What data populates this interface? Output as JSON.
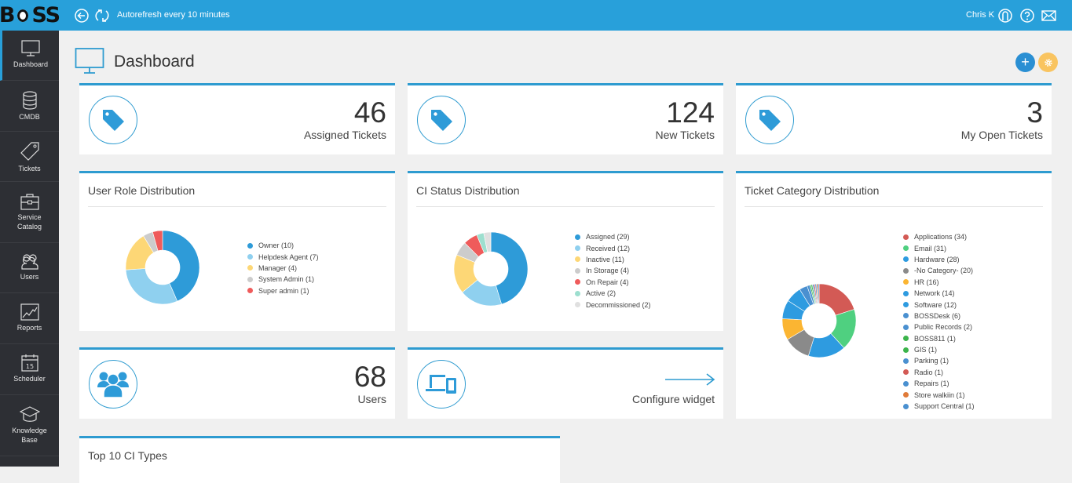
{
  "topbar": {
    "logo": "BOSS",
    "autorefresh": "Autorefresh every 10 minutes",
    "user_name": "Chris K"
  },
  "sidebar": {
    "items": [
      {
        "label": "Dashboard",
        "icon": "monitor-icon",
        "active": true
      },
      {
        "label": "CMDB",
        "icon": "database-icon"
      },
      {
        "label": "Tickets",
        "icon": "tag-icon"
      },
      {
        "label": "Service Catalog",
        "icon": "briefcase-icon"
      },
      {
        "label": "Users",
        "icon": "users-icon"
      },
      {
        "label": "Reports",
        "icon": "chart-icon"
      },
      {
        "label": "Scheduler",
        "icon": "calendar-icon",
        "calendar_day": "15"
      },
      {
        "label": "Knowledge Base",
        "icon": "graduation-cap-icon"
      }
    ]
  },
  "page": {
    "title": "Dashboard",
    "add_button": "+",
    "colors": {
      "accent": "#2e9bd0",
      "settings": "#f9c460"
    }
  },
  "stats": {
    "assigned": {
      "value": "46",
      "label": "Assigned Tickets"
    },
    "new": {
      "value": "124",
      "label": "New Tickets"
    },
    "open": {
      "value": "3",
      "label": "My Open Tickets"
    },
    "users": {
      "value": "68",
      "label": "Users"
    },
    "configure": {
      "label": "Configure widget"
    }
  },
  "top_ci": {
    "title": "Top 10 CI Types"
  },
  "chart_data": [
    {
      "type": "pie",
      "title": "User Role Distribution",
      "legend": "right",
      "slices": [
        {
          "label": "Owner (10)",
          "name": "Owner",
          "value": 10,
          "color": "#2e9bd8"
        },
        {
          "label": "Helpdesk Agent (7)",
          "name": "Helpdesk Agent",
          "value": 7,
          "color": "#8fd0ef"
        },
        {
          "label": "Manager (4)",
          "name": "Manager",
          "value": 4,
          "color": "#fdd776"
        },
        {
          "label": "System Admin (1)",
          "name": "System Admin",
          "value": 1,
          "color": "#cccccc"
        },
        {
          "label": "Super admin (1)",
          "name": "Super admin",
          "value": 1,
          "color": "#ef5b5b"
        }
      ]
    },
    {
      "type": "pie",
      "title": "CI Status Distribution",
      "legend": "right",
      "slices": [
        {
          "label": "Assigned (29)",
          "name": "Assigned",
          "value": 29,
          "color": "#2e9bd8"
        },
        {
          "label": "Received (12)",
          "name": "Received",
          "value": 12,
          "color": "#8fd0ef"
        },
        {
          "label": "Inactive (11)",
          "name": "Inactive",
          "value": 11,
          "color": "#fdd776"
        },
        {
          "label": "In Storage (4)",
          "name": "In Storage",
          "value": 4,
          "color": "#cccccc"
        },
        {
          "label": "On Repair (4)",
          "name": "On Repair",
          "value": 4,
          "color": "#ef5b5b"
        },
        {
          "label": "Active (2)",
          "name": "Active",
          "value": 2,
          "color": "#9ddfcf"
        },
        {
          "label": "Decommissioned (2)",
          "name": "Decommissioned",
          "value": 2,
          "color": "#e0e0e0"
        }
      ]
    },
    {
      "type": "pie",
      "title": "Ticket Category Distribution",
      "legend": "right",
      "slices": [
        {
          "label": "Applications (34)",
          "name": "Applications",
          "value": 34,
          "color": "#d35a55"
        },
        {
          "label": "Email (31)",
          "name": "Email",
          "value": 31,
          "color": "#4fd080"
        },
        {
          "label": "Hardware (28)",
          "name": "Hardware",
          "value": 28,
          "color": "#2e9be0"
        },
        {
          "label": "-No Category- (20)",
          "name": "-No Category-",
          "value": 20,
          "color": "#8a8a8a"
        },
        {
          "label": "HR (16)",
          "name": "HR",
          "value": 16,
          "color": "#fbb532"
        },
        {
          "label": "Network (14)",
          "name": "Network",
          "value": 14,
          "color": "#2e9be0"
        },
        {
          "label": "Software (12)",
          "name": "Software",
          "value": 12,
          "color": "#2e9be0"
        },
        {
          "label": "BOSSDesk (6)",
          "name": "BOSSDesk",
          "value": 6,
          "color": "#4a90d0"
        },
        {
          "label": "Public Records (2)",
          "name": "Public Records",
          "value": 2,
          "color": "#4a90d0"
        },
        {
          "label": "BOSS811 (1)",
          "name": "BOSS811",
          "value": 1,
          "color": "#3cb44b"
        },
        {
          "label": "GIS (1)",
          "name": "GIS",
          "value": 1,
          "color": "#3cb44b"
        },
        {
          "label": "Parking (1)",
          "name": "Parking",
          "value": 1,
          "color": "#4a90d0"
        },
        {
          "label": "Radio (1)",
          "name": "Radio",
          "value": 1,
          "color": "#d35a55"
        },
        {
          "label": "Repairs (1)",
          "name": "Repairs",
          "value": 1,
          "color": "#4a90d0"
        },
        {
          "label": "Store walkiin (1)",
          "name": "Store walkiin",
          "value": 1,
          "color": "#e07b39"
        },
        {
          "label": "Support Central (1)",
          "name": "Support Central",
          "value": 1,
          "color": "#4a90d0"
        }
      ]
    }
  ]
}
